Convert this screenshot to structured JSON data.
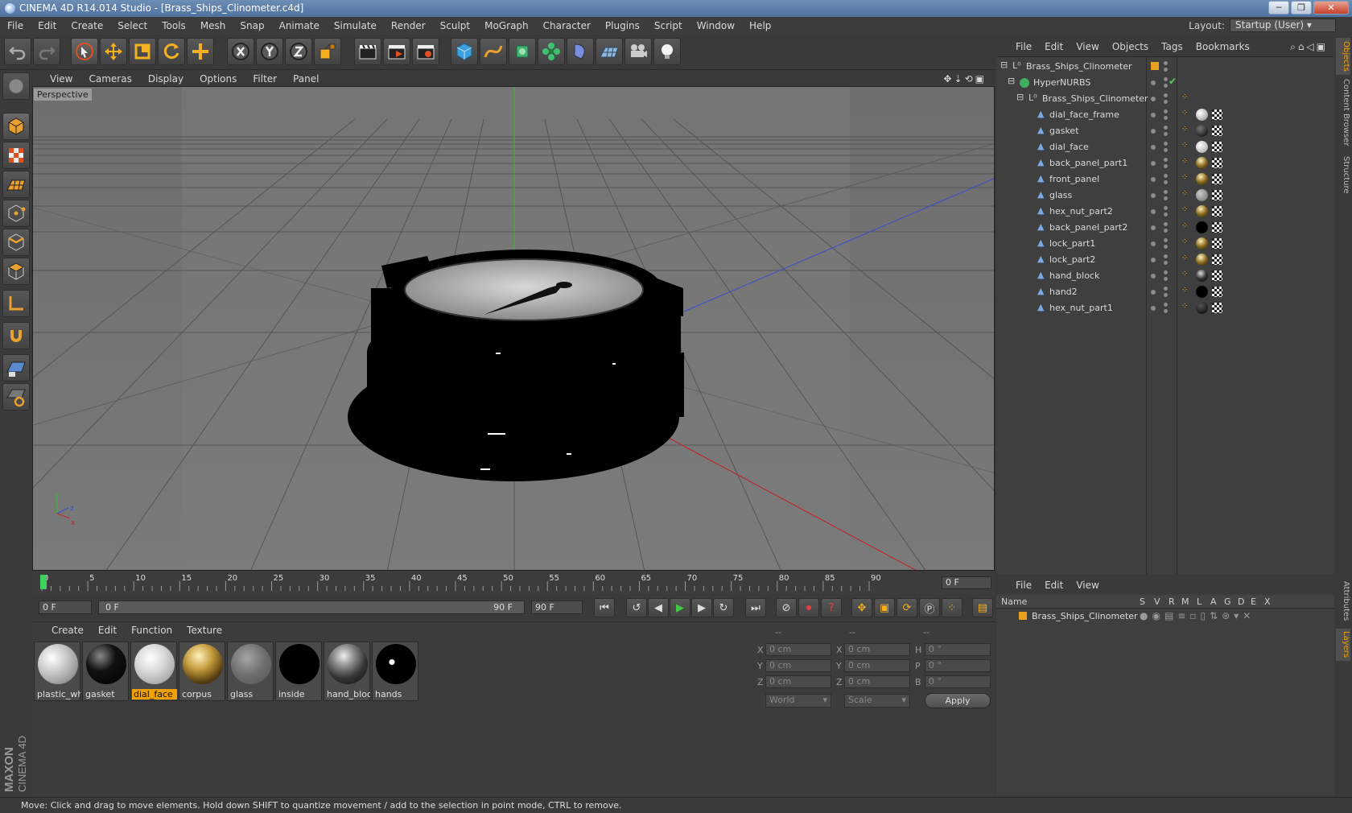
{
  "window": {
    "title": "CINEMA 4D R14.014 Studio - [Brass_Ships_Clinometer.c4d]",
    "buttons": [
      "─",
      "❐",
      "✕"
    ]
  },
  "menubar": [
    "File",
    "Edit",
    "Create",
    "Select",
    "Tools",
    "Mesh",
    "Snap",
    "Animate",
    "Simulate",
    "Render",
    "Sculpt",
    "MoGraph",
    "Character",
    "Plugins",
    "Script",
    "Window",
    "Help"
  ],
  "layout": {
    "label": "Layout:",
    "value": "Startup (User)"
  },
  "viewport": {
    "menu": [
      "View",
      "Cameras",
      "Display",
      "Options",
      "Filter",
      "Panel"
    ],
    "label": "Perspective",
    "axis_labels": [
      "x",
      "y",
      "z"
    ]
  },
  "timeline": {
    "ticks": [
      "0",
      "5",
      "10",
      "15",
      "20",
      "25",
      "30",
      "35",
      "40",
      "45",
      "50",
      "55",
      "60",
      "65",
      "70",
      "75",
      "80",
      "85",
      "90"
    ],
    "frame_field": "0 F",
    "start_field": "0 F",
    "slider_left": "0 F",
    "slider_right": "90 F",
    "end_field": "90 F"
  },
  "materials": {
    "menu": [
      "Create",
      "Edit",
      "Function",
      "Texture"
    ],
    "items": [
      {
        "label": "plastic_whi"
      },
      {
        "label": "gasket"
      },
      {
        "label": "dial_face"
      },
      {
        "label": "corpus"
      },
      {
        "label": "glass"
      },
      {
        "label": "inside"
      },
      {
        "label": "hand_block"
      },
      {
        "label": "hands"
      }
    ],
    "selected": "dial_face"
  },
  "coordinates": {
    "header": [
      "--",
      "--",
      "--"
    ],
    "rows": [
      {
        "k1": "X",
        "v1": "0 cm",
        "k2": "X",
        "v2": "0 cm",
        "k3": "H",
        "v3": "0 °"
      },
      {
        "k1": "Y",
        "v1": "0 cm",
        "k2": "Y",
        "v2": "0 cm",
        "k3": "P",
        "v3": "0 °"
      },
      {
        "k1": "Z",
        "v1": "0 cm",
        "k2": "Z",
        "v2": "0 cm",
        "k3": "B",
        "v3": "0 °"
      }
    ],
    "mode": "World",
    "scale": "Scale",
    "apply": "Apply"
  },
  "objects": {
    "menu": [
      "File",
      "Edit",
      "View",
      "Objects",
      "Tags",
      "Bookmarks"
    ],
    "root": "Brass_Ships_Clinometer",
    "nurbs": "HyperNURBS",
    "group": "Brass_Ships_Clinometer",
    "children": [
      "dial_face_frame",
      "gasket",
      "dial_face",
      "back_panel_part1",
      "front_panel",
      "glass",
      "hex_nut_part2",
      "back_panel_part2",
      "lock_part1",
      "lock_part2",
      "hand_block",
      "hand2",
      "hex_nut_part1"
    ]
  },
  "layers": {
    "menu": [
      "File",
      "Edit",
      "View"
    ],
    "columns": [
      "Name",
      "S",
      "V",
      "R",
      "M",
      "L",
      "A",
      "G",
      "D",
      "E",
      "X"
    ],
    "row": "Brass_Ships_Clinometer"
  },
  "sidetabs": [
    "Objects",
    "Content Browser",
    "Structure",
    "Attributes",
    "Layers"
  ],
  "status": "Move: Click and drag to move elements. Hold down SHIFT to quantize movement / add to the selection in point mode, CTRL to remove.",
  "brand": {
    "maxon": "MAXON",
    "product": "CINEMA 4D"
  },
  "colors": {
    "accent": "#f0a000",
    "background": "#3a3a3a",
    "viewport": "#747474",
    "title": "#5b7eaa"
  }
}
